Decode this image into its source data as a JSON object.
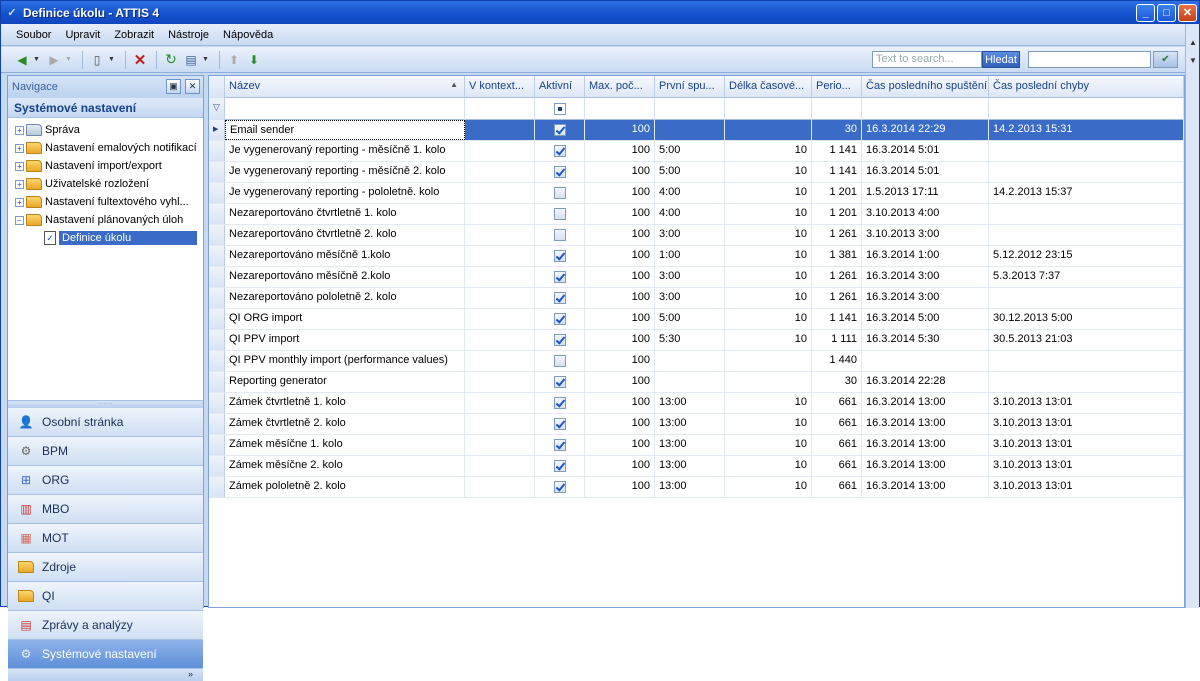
{
  "window": {
    "title": "Definice úkolu - ATTIS 4"
  },
  "menu": [
    "Soubor",
    "Upravit",
    "Zobrazit",
    "Nástroje",
    "Nápověda"
  ],
  "toolbar": {
    "search_placeholder": "Text to search...",
    "search_button": "Hledat"
  },
  "nav": {
    "header": "Navigace",
    "section_title": "Systémové nastavení",
    "tree": [
      {
        "label": "Správa",
        "icon": "admin-icon"
      },
      {
        "label": "Nastavení emalových notifikací",
        "icon": "folder-icon"
      },
      {
        "label": "Nastavení import/export",
        "icon": "folder-icon"
      },
      {
        "label": "Uživatelské rozložení",
        "icon": "folder-icon"
      },
      {
        "label": "Nastavení fultextového vyhl...",
        "icon": "folder-icon"
      },
      {
        "label": "Nastavení plánovaných úloh",
        "icon": "folder-icon"
      }
    ],
    "tree_child": {
      "label": "Definice úkolu",
      "icon": "task-definition-icon"
    },
    "modules": [
      {
        "label": "Osobní stránka",
        "icon": "person-icon"
      },
      {
        "label": "BPM",
        "icon": "bpm-icon"
      },
      {
        "label": "ORG",
        "icon": "org-chart-icon"
      },
      {
        "label": "MBO",
        "icon": "bar-chart-icon"
      },
      {
        "label": "MOT",
        "icon": "mot-icon"
      },
      {
        "label": "Zdroje",
        "icon": "folder-icon"
      },
      {
        "label": "QI",
        "icon": "folder-icon"
      },
      {
        "label": "Zprávy a analýzy",
        "icon": "report-icon"
      },
      {
        "label": "Systémové nastavení",
        "icon": "gear-icon"
      }
    ],
    "footer_glyph": "»"
  },
  "grid": {
    "columns": [
      "Název",
      "V kontext...",
      "Aktivní",
      "Max. poč...",
      "První spu...",
      "Délka časové...",
      "Perio...",
      "Čas posledního spuštění",
      "Čas poslední chyby"
    ],
    "rows": [
      {
        "name": "Email sender",
        "active": true,
        "max": "100",
        "first": "",
        "length": "",
        "period": "30",
        "last_run": "16.3.2014 22:29",
        "last_error": "14.2.2013 15:31"
      },
      {
        "name": "Je vygenerovaný reporting - měsíčně 1. kolo",
        "active": true,
        "max": "100",
        "first": "5:00",
        "length": "10",
        "period": "1 141",
        "last_run": "16.3.2014 5:01",
        "last_error": ""
      },
      {
        "name": "Je vygenerovaný reporting - měsíčně 2. kolo",
        "active": true,
        "max": "100",
        "first": "5:00",
        "length": "10",
        "period": "1 141",
        "last_run": "16.3.2014 5:01",
        "last_error": ""
      },
      {
        "name": "Je vygenerovaný reporting - pololetně. kolo",
        "active": false,
        "max": "100",
        "first": "4:00",
        "length": "10",
        "period": "1 201",
        "last_run": "1.5.2013 17:11",
        "last_error": "14.2.2013 15:37"
      },
      {
        "name": "Nezareportováno čtvrtletně 1. kolo",
        "active": false,
        "max": "100",
        "first": "4:00",
        "length": "10",
        "period": "1 201",
        "last_run": "3.10.2013 4:00",
        "last_error": ""
      },
      {
        "name": "Nezareportováno čtvrtletně 2. kolo",
        "active": false,
        "max": "100",
        "first": "3:00",
        "length": "10",
        "period": "1 261",
        "last_run": "3.10.2013 3:00",
        "last_error": ""
      },
      {
        "name": "Nezareportováno měsíčně 1.kolo",
        "active": true,
        "max": "100",
        "first": "1:00",
        "length": "10",
        "period": "1 381",
        "last_run": "16.3.2014 1:00",
        "last_error": "5.12.2012 23:15"
      },
      {
        "name": "Nezareportováno měsíčně 2.kolo",
        "active": true,
        "max": "100",
        "first": "3:00",
        "length": "10",
        "period": "1 261",
        "last_run": "16.3.2014 3:00",
        "last_error": "5.3.2013 7:37"
      },
      {
        "name": "Nezareportováno pololetně 2. kolo",
        "active": true,
        "max": "100",
        "first": "3:00",
        "length": "10",
        "period": "1 261",
        "last_run": "16.3.2014 3:00",
        "last_error": ""
      },
      {
        "name": "QI ORG import",
        "active": true,
        "max": "100",
        "first": "5:00",
        "length": "10",
        "period": "1 141",
        "last_run": "16.3.2014 5:00",
        "last_error": "30.12.2013 5:00"
      },
      {
        "name": "QI PPV import",
        "active": true,
        "max": "100",
        "first": "5:30",
        "length": "10",
        "period": "1 111",
        "last_run": "16.3.2014 5:30",
        "last_error": "30.5.2013 21:03"
      },
      {
        "name": "QI PPV monthly import (performance values)",
        "active": false,
        "max": "100",
        "first": "",
        "length": "",
        "period": "1 440",
        "last_run": "",
        "last_error": ""
      },
      {
        "name": "Reporting generator",
        "active": true,
        "max": "100",
        "first": "",
        "length": "",
        "period": "30",
        "last_run": "16.3.2014 22:28",
        "last_error": ""
      },
      {
        "name": "Zámek čtvrtletně 1. kolo",
        "active": true,
        "max": "100",
        "first": "13:00",
        "length": "10",
        "period": "661",
        "last_run": "16.3.2014 13:00",
        "last_error": "3.10.2013 13:01"
      },
      {
        "name": "Zámek čtvrtletně 2. kolo",
        "active": true,
        "max": "100",
        "first": "13:00",
        "length": "10",
        "period": "661",
        "last_run": "16.3.2014 13:00",
        "last_error": "3.10.2013 13:01"
      },
      {
        "name": "Zámek měsíčne 1. kolo",
        "active": true,
        "max": "100",
        "first": "13:00",
        "length": "10",
        "period": "661",
        "last_run": "16.3.2014 13:00",
        "last_error": "3.10.2013 13:01"
      },
      {
        "name": "Zámek měsíčne 2. kolo",
        "active": true,
        "max": "100",
        "first": "13:00",
        "length": "10",
        "period": "661",
        "last_run": "16.3.2014 13:00",
        "last_error": "3.10.2013 13:01"
      },
      {
        "name": "Zámek pololetně 2. kolo",
        "active": true,
        "max": "100",
        "first": "13:00",
        "length": "10",
        "period": "661",
        "last_run": "16.3.2014 13:00",
        "last_error": "3.10.2013 13:01"
      }
    ]
  }
}
